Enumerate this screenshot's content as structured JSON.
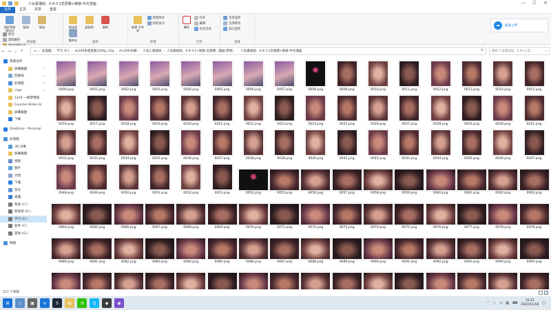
{
  "window": {
    "title": "少女素描绘、0.9-3.1恋爱赌+链接-中文漫画",
    "minimize": "—",
    "maximize": "☐",
    "close": "✕"
  },
  "ribbon_tabs": [
    "文件",
    "主页",
    "共享",
    "查看"
  ],
  "ribbon": {
    "clipboard": {
      "label": "剪贴板",
      "pin": "固定到快速访问",
      "copy": "复制",
      "paste": "粘贴",
      "cut": "剪切",
      "copy_path": "复制路径",
      "paste_shortcut": "粘贴快捷方式"
    },
    "organize": {
      "label": "组织",
      "move_to": "移动到",
      "copy_to": "复制到",
      "delete": "删除",
      "rename": "重命名"
    },
    "new": {
      "label": "新建",
      "new_folder": "新建\n文件夹",
      "new_item": "新建项目",
      "easy_access": "轻松访问"
    },
    "open": {
      "label": "打开",
      "properties": "属性",
      "open": "打开",
      "edit": "编辑",
      "history": "历史记录"
    },
    "select": {
      "label": "选择",
      "select_all": "全部选择",
      "select_none": "全部取消",
      "invert": "反向选择"
    },
    "cloud_label": "加速上传"
  },
  "address": {
    "crumbs": [
      "此电脑",
      "学习 (E:)",
      "as109去底金素1500p_15g",
      "As109(光碟)",
      "少女と素描绘",
      "少女素描绘、0.9-3.1+链接-恋爱赌（漫画·游戏）",
      "少女素描绘、0.9-3.1恋爱赌+链接-中文漫画"
    ],
    "search_placeholder": "搜索“少女素描绘、0.9-3.1恋..."
  },
  "nav": [
    {
      "label": "快速访问",
      "icon": "star-icon",
      "color": "#2b7de1",
      "top": true
    },
    {
      "label": "屏幕截图",
      "icon": "folder-icon",
      "color": "#e8c15a",
      "pin": true
    },
    {
      "label": "回收站",
      "icon": "recycle-bin-icon",
      "color": "#7aa7d6",
      "pin": true
    },
    {
      "label": "此电脑",
      "icon": "computer-icon",
      "color": "#4a90d9",
      "pin": true
    },
    {
      "label": "csgo",
      "icon": "folder-icon",
      "color": "#e8c15a",
      "pin": true
    },
    {
      "label": "1234 —被禁用图",
      "icon": "folder-icon",
      "color": "#e8c15a"
    },
    {
      "label": "Counter-Strike Gl",
      "icon": "folder-icon",
      "color": "#e8c15a"
    },
    {
      "label": "屏幕截图",
      "icon": "folder-icon",
      "color": "#e8c15a"
    },
    {
      "label": "下载",
      "icon": "download-icon",
      "color": "#2b7de1"
    },
    {
      "label": "OneDrive - Personal",
      "icon": "cloud-icon",
      "color": "#2b7de1",
      "top": true,
      "gap": true
    },
    {
      "label": "此电脑",
      "icon": "computer-icon",
      "color": "#4a90d9",
      "top": true,
      "gap": true
    },
    {
      "label": "3D 对象",
      "icon": "cube-icon",
      "color": "#5b9bd5"
    },
    {
      "label": "屏幕截图",
      "icon": "folder-icon",
      "color": "#e8c15a"
    },
    {
      "label": "视频",
      "icon": "video-icon",
      "color": "#6a8cc9"
    },
    {
      "label": "图片",
      "icon": "picture-icon",
      "color": "#5ca3d8"
    },
    {
      "label": "文档",
      "icon": "document-icon",
      "color": "#8aa3c6"
    },
    {
      "label": "下载",
      "icon": "download-icon",
      "color": "#2b7de1"
    },
    {
      "label": "音乐",
      "icon": "music-icon",
      "color": "#5b8fd6"
    },
    {
      "label": "桌面",
      "icon": "desktop-icon",
      "color": "#3d7fd4"
    },
    {
      "label": "系统 (C:)",
      "icon": "drive-icon",
      "color": "#777"
    },
    {
      "label": "新加卷 (D:)",
      "icon": "drive-icon",
      "color": "#777"
    },
    {
      "label": "学习 (E:)",
      "icon": "drive-icon",
      "color": "#777",
      "selected": true
    },
    {
      "label": "软件 (F:)",
      "icon": "drive-icon",
      "color": "#777"
    },
    {
      "label": "游戏 (G:)",
      "icon": "drive-icon",
      "color": "#777"
    },
    {
      "label": "网络",
      "icon": "network-icon",
      "color": "#4a90d9",
      "top": true,
      "gap": true
    }
  ],
  "files": [
    "0000.png",
    "0001.png",
    "0002.png",
    "0003.png",
    "0004.png",
    "0005.png",
    "0006.png",
    "0007.png",
    "0008.png",
    "0009.png",
    "0010.png",
    "0011.png",
    "0012.png",
    "0013.png",
    "0014.png",
    "0015.png",
    "0016.png",
    "0017.png",
    "0018.png",
    "0019.png",
    "0020.png",
    "0021.png",
    "0022.png",
    "0023.png",
    "0024.png",
    "0025.png",
    "0026.png",
    "0027.png",
    "0028.png",
    "0029.png",
    "0030.png",
    "0031.png",
    "0032.png",
    "0033.png",
    "0034.png",
    "0035.png",
    "0036.png",
    "0037.png",
    "0038.png",
    "0039.png",
    "0040.png",
    "0041.png",
    "0042.png",
    "0043.png",
    "0044.png",
    "0045.png",
    "0046.png",
    "0047.png",
    "0048.png",
    "0049.png",
    "0050.png",
    "0051.png",
    "0052.png",
    "0053.png",
    "0054.png",
    "0055.png",
    "0056.png",
    "0057.png",
    "0058.png",
    "0059.png",
    "0060.png",
    "0061.png",
    "0062.png",
    "0063.png",
    "0064.png",
    "0065.png",
    "0066.png",
    "0067.png",
    "0068.png",
    "0069.png",
    "0070.png",
    "0071.png",
    "0072.png",
    "0073.png",
    "0074.png",
    "0075.png",
    "0076.png",
    "0077.png",
    "0078.png",
    "0079.png",
    "0080.png",
    "0081.png",
    "0082.png",
    "0083.png",
    "0084.png",
    "0085.png",
    "0086.png",
    "0087.png",
    "0088.png",
    "0089.png",
    "0090.png",
    "0091.png",
    "0092.png",
    "0093.png",
    "0094.png",
    "0095.png",
    "0096.png",
    "0097.png",
    "0098.png",
    "0099.png",
    "0100.png",
    "0101.png",
    "0102.png",
    "0103.png",
    "0104.png",
    "0105.png",
    "0106.png",
    "0107.png",
    "0108.png",
    "0109.png",
    "0110.png",
    "0111.png"
  ],
  "status": {
    "item_count": "227 个项目"
  },
  "taskbar": {
    "tray_lang": "英",
    "time": "15:21",
    "date": "2023/11/18"
  },
  "colors": {
    "accent": "#1e6ec8",
    "selection": "#cce4f7"
  }
}
